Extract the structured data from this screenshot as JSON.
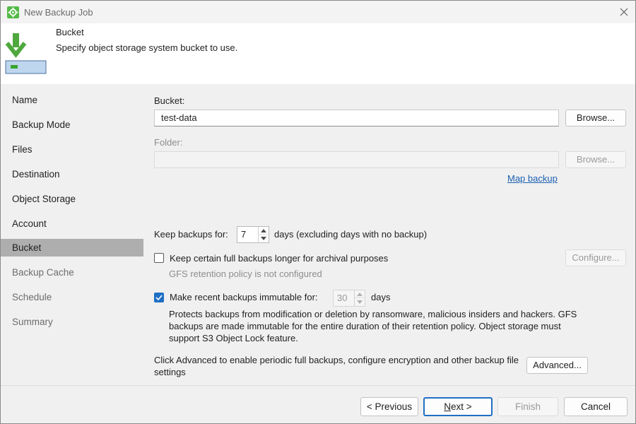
{
  "window": {
    "title": "New Backup Job",
    "close_icon": "close-icon"
  },
  "header": {
    "title": "Bucket",
    "description": "Specify object storage system bucket to use."
  },
  "sidebar": {
    "items": [
      {
        "label": "Name",
        "state": "normal"
      },
      {
        "label": "Backup Mode",
        "state": "normal"
      },
      {
        "label": "Files",
        "state": "normal"
      },
      {
        "label": "Destination",
        "state": "normal"
      },
      {
        "label": "Object Storage",
        "state": "normal"
      },
      {
        "label": "Account",
        "state": "normal"
      },
      {
        "label": "Bucket",
        "state": "active"
      },
      {
        "label": "Backup Cache",
        "state": "disabled"
      },
      {
        "label": "Schedule",
        "state": "disabled"
      },
      {
        "label": "Summary",
        "state": "disabled"
      }
    ]
  },
  "main": {
    "bucket_label": "Bucket:",
    "bucket_value": "test-data",
    "bucket_browse": "Browse...",
    "folder_label": "Folder:",
    "folder_value": "",
    "folder_browse": "Browse...",
    "map_backup": "Map backup",
    "keep_label": "Keep backups for:",
    "keep_value": "7",
    "keep_suffix": "days (excluding days with no backup)",
    "gfs_checkbox_label": "Keep certain full backups longer for archival purposes",
    "gfs_checked": false,
    "configure_button": "Configure...",
    "gfs_status": "GFS retention policy is not configured",
    "immutable_checkbox_label": "Make recent backups immutable for:",
    "immutable_checked": true,
    "immutable_value": "30",
    "immutable_suffix": "days",
    "immutable_note": "Protects backups from modification or deletion by ransomware, malicious insiders and hackers. GFS backups are made immutable for the entire duration of their retention policy. Object storage must support S3 Object Lock feature.",
    "advanced_text": "Click Advanced to enable periodic full backups, configure encryption and other backup file settings",
    "advanced_button": "Advanced..."
  },
  "footer": {
    "previous": "< Previous",
    "next_prefix": "N",
    "next_rest": "ext >",
    "finish": "Finish",
    "cancel": "Cancel"
  },
  "colors": {
    "accent": "#1f6fc5",
    "brand_green": "#54b948",
    "active_nav": "#aeaeae",
    "link": "#1a5fb4"
  }
}
